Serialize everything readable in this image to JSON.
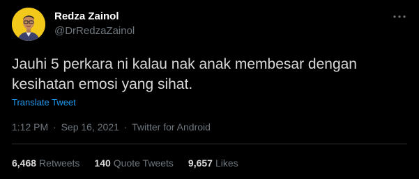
{
  "tweet": {
    "author": {
      "name": "Redza Zainol",
      "handle": "@DrRedzaZainol"
    },
    "text_lines": [
      "Jauhi 5 perkara ni kalau nak anak membesar dengan",
      "kesihatan emosi yang sihat."
    ],
    "translate_label": "Translate Tweet",
    "time": "1:12 PM",
    "date": "Sep 16, 2021",
    "source": "Twitter for Android",
    "separator": "·",
    "stats": {
      "retweets_count": "6,468",
      "retweets_label": "Retweets",
      "quotes_count": "140",
      "quotes_label": "Quote Tweets",
      "likes_count": "9,657",
      "likes_label": "Likes"
    }
  },
  "icons": {
    "avatar": "avatar-photo",
    "more": "more-options-icon"
  },
  "colors": {
    "background": "#000000",
    "text": "#d9d9d9",
    "secondary": "#6e767d",
    "link": "#1d9bf0",
    "avatar_bg": "#f2c81b"
  }
}
